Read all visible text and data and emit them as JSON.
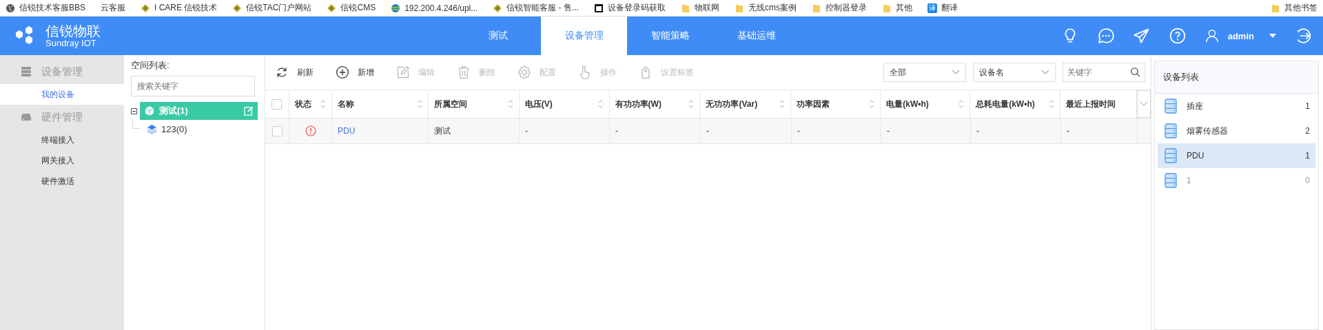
{
  "bookmarks": [
    {
      "kind": "globe",
      "label": "信锐技术客服BBS"
    },
    {
      "kind": "plain",
      "label": "云客服"
    },
    {
      "kind": "brand",
      "label": "I CARE 信锐技术"
    },
    {
      "kind": "brand",
      "label": "信锐TAC门户网站"
    },
    {
      "kind": "brand",
      "label": "信锐CMS"
    },
    {
      "kind": "earth",
      "label": "192.200.4.246/upl..."
    },
    {
      "kind": "brand",
      "label": "信锐智能客服 - 售..."
    },
    {
      "kind": "page",
      "label": "设备登录码获取"
    },
    {
      "kind": "folder",
      "label": "物联网"
    },
    {
      "kind": "folder",
      "label": "无线cms案例"
    },
    {
      "kind": "folder",
      "label": "控制器登录"
    },
    {
      "kind": "folder",
      "label": "其他"
    },
    {
      "kind": "translate",
      "label": "翻译",
      "glyph": "译"
    }
  ],
  "other_bookmarks": {
    "label": "其他书签"
  },
  "header": {
    "logo_title": "信锐物联",
    "logo_subtitle": "Sundray IOT",
    "tabs": [
      {
        "label": "测试",
        "selected": false
      },
      {
        "label": "设备管理",
        "selected": true
      },
      {
        "label": "智能策略",
        "selected": false
      },
      {
        "label": "基础运维",
        "selected": false
      }
    ],
    "user": "admin"
  },
  "sidebar": {
    "groups": [
      {
        "label": "设备管理",
        "kind": "device",
        "children": [
          {
            "label": "我的设备",
            "selected": true
          }
        ]
      },
      {
        "label": "硬件管理",
        "kind": "hardware",
        "children": [
          {
            "label": "终端接入",
            "selected": false
          },
          {
            "label": "网关接入",
            "selected": false
          },
          {
            "label": "硬件激活",
            "selected": false
          }
        ]
      }
    ]
  },
  "space_tree": {
    "title": "空间列表:",
    "search_placeholder": "搜索关键字",
    "nodes": [
      {
        "label": "测试(1)",
        "selected": true,
        "expanded": true,
        "children": [
          {
            "label": "123(0)",
            "selected": false
          }
        ]
      }
    ]
  },
  "toolbar": {
    "buttons": [
      {
        "kind": "refresh",
        "label": "刷新",
        "disabled": false
      },
      {
        "kind": "add",
        "label": "新增",
        "disabled": false
      },
      {
        "kind": "edit",
        "label": "编辑",
        "disabled": true
      },
      {
        "kind": "delete",
        "label": "删除",
        "disabled": true
      },
      {
        "kind": "config",
        "label": "配置",
        "disabled": true
      },
      {
        "kind": "operate",
        "label": "操作",
        "disabled": true
      },
      {
        "kind": "tag",
        "label": "设置标签",
        "disabled": true
      }
    ],
    "filters": [
      {
        "kind": "select",
        "value": "全部"
      },
      {
        "kind": "select",
        "value": "设备名"
      },
      {
        "kind": "search",
        "placeholder": "关键字"
      }
    ]
  },
  "table": {
    "columns": [
      {
        "label": "状态",
        "sortable": true
      },
      {
        "label": "名称",
        "sortable": true
      },
      {
        "label": "所属空间",
        "sortable": true
      },
      {
        "label": "电压(V)",
        "sortable": true
      },
      {
        "label": "有功功率(W)",
        "sortable": true
      },
      {
        "label": "无功功率(Var)",
        "sortable": true
      },
      {
        "label": "功率因素",
        "sortable": true
      },
      {
        "label": "电量(kW•h)",
        "sortable": true
      },
      {
        "label": "总耗电量(kW•h)",
        "sortable": true
      },
      {
        "label": "最近上报时间",
        "sortable": false
      }
    ],
    "select_all_checked": false,
    "rows": [
      {
        "checked": false,
        "alert": true,
        "cells": [
          "",
          "PDU",
          "测试",
          "-",
          "-",
          "-",
          "-",
          "-",
          "-",
          "-"
        ]
      }
    ]
  },
  "device_list": {
    "title": "设备列表",
    "items": [
      {
        "name": "插座",
        "count": "1",
        "selected": false,
        "disabled": false
      },
      {
        "name": "烟雾传感器",
        "count": "2",
        "selected": false,
        "disabled": false
      },
      {
        "name": "PDU",
        "count": "1",
        "selected": true,
        "disabled": false
      },
      {
        "name": "1",
        "count": "0",
        "selected": false,
        "disabled": true
      }
    ]
  }
}
